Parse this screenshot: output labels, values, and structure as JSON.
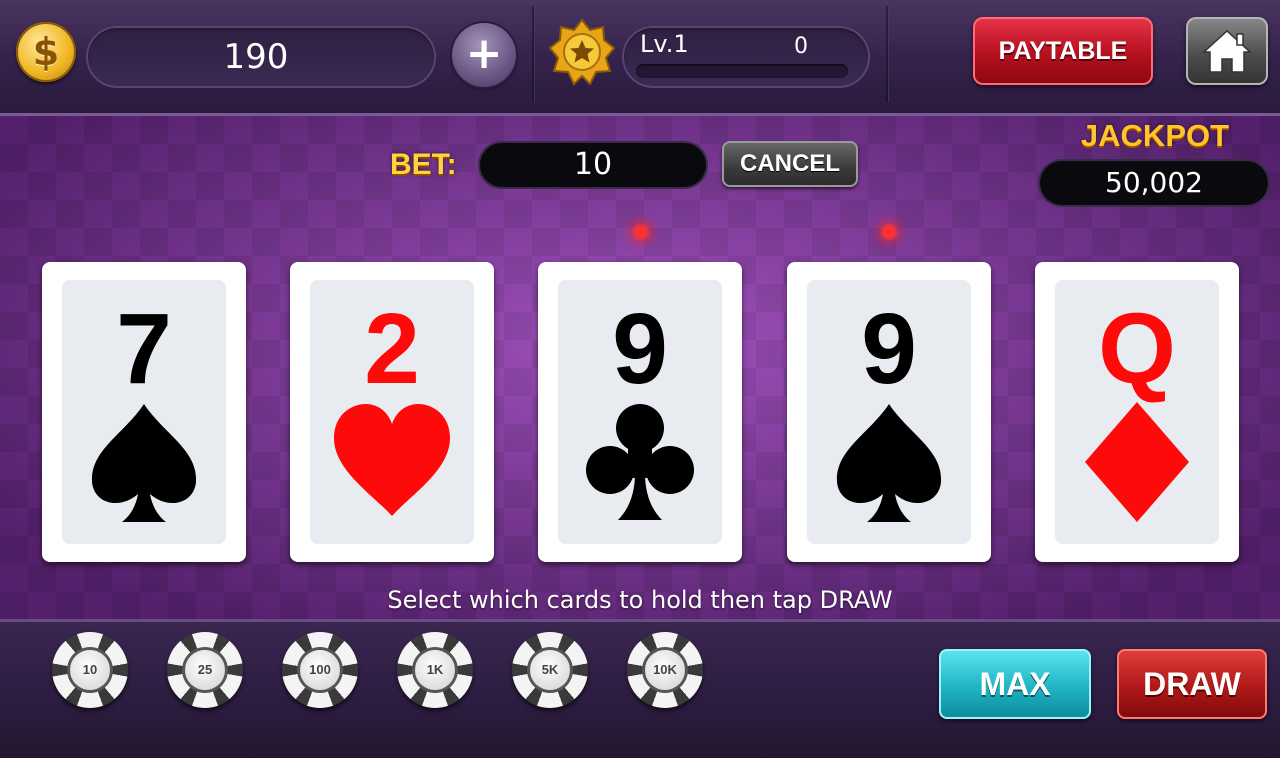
{
  "header": {
    "coin_symbol": "$",
    "coins": "190",
    "add_coins_symbol": "+",
    "level_label": "Lv.1",
    "level_xp": "0",
    "level_progress": 0,
    "paytable_label": "PAYTABLE"
  },
  "game": {
    "bet_label": "BET:",
    "bet_value": "10",
    "cancel_label": "CANCEL",
    "jackpot_label": "JACKPOT",
    "jackpot_value": "50,002",
    "instruction": "Select which cards to hold then tap DRAW"
  },
  "cards": [
    {
      "rank": "7",
      "suit": "spades",
      "color": "#000000",
      "held": false
    },
    {
      "rank": "2",
      "suit": "hearts",
      "color": "#ff0a0a",
      "held": false
    },
    {
      "rank": "9",
      "suit": "clubs",
      "color": "#000000",
      "held": true
    },
    {
      "rank": "9",
      "suit": "spades",
      "color": "#000000",
      "held": true
    },
    {
      "rank": "Q",
      "suit": "diamonds",
      "color": "#ff0a0a",
      "held": false
    }
  ],
  "chips": [
    "10",
    "25",
    "100",
    "1K",
    "5K",
    "10K"
  ],
  "controls": {
    "max_label": "MAX",
    "draw_label": "DRAW"
  },
  "colors": {
    "accent_gold": "#ffc52a",
    "paytable_red": "#c81c2a",
    "max_teal": "#1fb4c4",
    "draw_red": "#b01818",
    "table_purple": "#8a3ca6",
    "hold_indicator": "#ff2020"
  }
}
